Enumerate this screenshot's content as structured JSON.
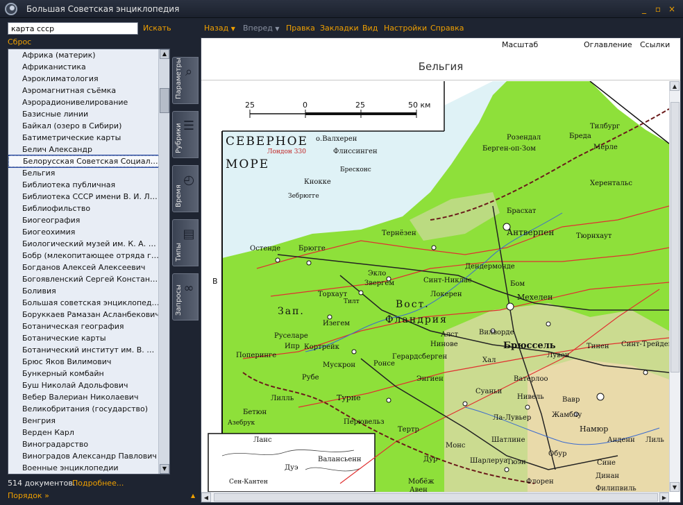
{
  "window": {
    "title": "Большая Советская энциклопедия",
    "controls": [
      "_",
      "▫",
      "×"
    ]
  },
  "search": {
    "value": "карта ссср",
    "button_label": "Искать",
    "reset_label": "Сброс"
  },
  "list": {
    "items": [
      "Африка (материк)",
      "Африканистика",
      "Аэроклиматология",
      "Аэромагнитная съёмка",
      "Аэрорадионивелирование",
      "Базисные линии",
      "Байкал (озеро в Сибири)",
      "Батиметрические карты",
      "Белич Александр",
      "Белорусская Советская Социалис...",
      "Бельгия",
      "Библиотека публичная",
      "Библиотека СССР имени В. И. Лен...",
      "Библиофильство",
      "Биогеография",
      "Биогеохимия",
      "Биологический музей им. К. А. Ти...",
      "Бобр (млекопитающее отряда гр...",
      "Богданов Алексей Алексеевич",
      "Богоявленский Сергей Константи...",
      "Боливия",
      "Большая советская энциклопедия",
      "Боруккаев Рамазан Асланбекович",
      "Ботаническая география",
      "Ботанические карты",
      "Ботанический институт им. В. Л. ...",
      "Брюс Яков Вилимович",
      "Бункерный комбайн",
      "Буш Николай Адольфович",
      "Вебер Валериан Николаевич",
      "Великобритания (государство)",
      "Венгрия",
      "Верден Карл",
      "Виноградарство",
      "Виноградов Александр Павлович",
      "Военные энциклопедии"
    ],
    "selected_index": 9
  },
  "side_tabs": [
    {
      "label": "Параметры",
      "icon": "magnifier-icon"
    },
    {
      "label": "Рубрики",
      "icon": "list-icon"
    },
    {
      "label": "Время",
      "icon": "stopwatch-icon"
    },
    {
      "label": "Типы",
      "icon": "documents-icon"
    },
    {
      "label": "Запросы",
      "icon": "binoculars-icon"
    }
  ],
  "footer": {
    "count": "514 документов.",
    "more_label": "Подробнее...",
    "order_label": "Порядок »"
  },
  "menu": {
    "back": "Назад",
    "forward": "Вперед",
    "items": [
      "Правка",
      "Закладки",
      "Вид",
      "Настройки",
      "Справка"
    ]
  },
  "document": {
    "tools": [
      "Масштаб",
      "Оглавление",
      "Ссылки"
    ],
    "title": "Бельгия",
    "side_letter": "В"
  },
  "map": {
    "scale_ticks": [
      "25",
      "0",
      "25",
      "50 км"
    ],
    "place_labels": [
      "СЕВЕРНОЕ",
      "МОРЕ",
      "о.Валхерен",
      "Флиссинген",
      "Лондон 330",
      "Бресконс",
      "Кнокке",
      "Зебрюгге",
      "Остенде",
      "Брюгге",
      "Тернёзен",
      "Берген-оп-Зом",
      "Тилбург",
      "Бреда",
      "Розендал",
      "Мерле",
      "Антверпен",
      "Тюрнхаут",
      "Брасхат",
      "Торхаут",
      "Тилт",
      "Синт-Никлас",
      "Экло",
      "Звергем",
      "Руселаре",
      "Изегем",
      "Мехелен",
      "Бом",
      "Локерен",
      "Вост.",
      "Фландрия",
      "Зап.",
      "Поперинге",
      "Ипр",
      "Кортрейк",
      "Алст",
      "Нинове",
      "Вилворде",
      "Брюссель",
      "Тинен",
      "Синт-Трейден",
      "Мускрон",
      "Ронсе",
      "Герардсберген",
      "Энгиен",
      "Рубе",
      "Лилль",
      "Турне",
      "Перювельз",
      "Тертр",
      "Монс",
      "Суаньи",
      "Ватерлоо",
      "Вавр",
      "Жамблу",
      "Намюр",
      "Шарлеруа",
      "Шатлине",
      "Тюэн",
      "Флорен",
      "Валансьенн",
      "Мобёж",
      "Авен",
      "Филипвиль",
      "Динан",
      "Сине",
      "Анденн",
      "Лиль",
      "Дуэ",
      "Бетюн",
      "Ланс",
      "Азебрук",
      "Лувен",
      "Ла-Лувьер",
      "Нивель",
      "Дур",
      "Обур",
      "Хал",
      "Дендермонде",
      "Херентальс",
      "Сен-Кантен"
    ]
  },
  "colors": {
    "accent": "#f0a000",
    "chrome_dark": "#1e2431",
    "list_bg": "#e8edf5",
    "map_land": "#8ee03a",
    "map_sea": "#dff2f6",
    "map_highland": "#d6d9a0",
    "map_roads": "#e03030"
  }
}
